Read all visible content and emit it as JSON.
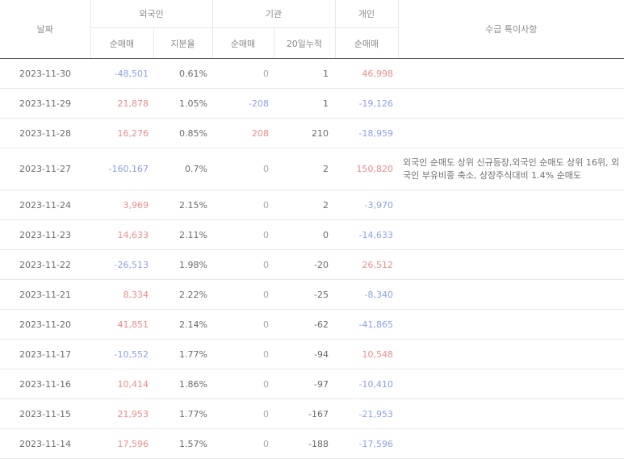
{
  "header": {
    "date": "날짜",
    "foreign": "외국인",
    "institution": "기관",
    "individual": "개인",
    "note": "수급 특이사항",
    "foreign_net": "순매매",
    "foreign_ratio": "지분율",
    "institution_net": "순매매",
    "institution_cum": "20일누적",
    "individual_net": "순매매"
  },
  "rows": [
    {
      "date": "2023-11-30",
      "foreign_net": "-48,501",
      "foreign_ratio": "0.61%",
      "institution_net": "0",
      "institution_cum": "1",
      "individual_net": "46,998",
      "note": ""
    },
    {
      "date": "2023-11-29",
      "foreign_net": "21,878",
      "foreign_ratio": "1.05%",
      "institution_net": "-208",
      "institution_cum": "1",
      "individual_net": "-19,126",
      "note": ""
    },
    {
      "date": "2023-11-28",
      "foreign_net": "16,276",
      "foreign_ratio": "0.85%",
      "institution_net": "208",
      "institution_cum": "210",
      "individual_net": "-18,959",
      "note": ""
    },
    {
      "date": "2023-11-27",
      "foreign_net": "-160,167",
      "foreign_ratio": "0.7%",
      "institution_net": "0",
      "institution_cum": "2",
      "individual_net": "150,820",
      "note": "외국인 순매도 상위 신규등장,외국인 순매도 상위 16위, 외국인 부유비중 축소, 상장주식대비 1.4% 순매도"
    },
    {
      "date": "2023-11-24",
      "foreign_net": "3,969",
      "foreign_ratio": "2.15%",
      "institution_net": "0",
      "institution_cum": "2",
      "individual_net": "-3,970",
      "note": ""
    },
    {
      "date": "2023-11-23",
      "foreign_net": "14,633",
      "foreign_ratio": "2.11%",
      "institution_net": "0",
      "institution_cum": "0",
      "individual_net": "-14,633",
      "note": ""
    },
    {
      "date": "2023-11-22",
      "foreign_net": "-26,513",
      "foreign_ratio": "1.98%",
      "institution_net": "0",
      "institution_cum": "-20",
      "individual_net": "26,512",
      "note": ""
    },
    {
      "date": "2023-11-21",
      "foreign_net": "8,334",
      "foreign_ratio": "2.22%",
      "institution_net": "0",
      "institution_cum": "-25",
      "individual_net": "-8,340",
      "note": ""
    },
    {
      "date": "2023-11-20",
      "foreign_net": "41,851",
      "foreign_ratio": "2.14%",
      "institution_net": "0",
      "institution_cum": "-62",
      "individual_net": "-41,865",
      "note": ""
    },
    {
      "date": "2023-11-17",
      "foreign_net": "-10,552",
      "foreign_ratio": "1.77%",
      "institution_net": "0",
      "institution_cum": "-94",
      "individual_net": "10,548",
      "note": ""
    },
    {
      "date": "2023-11-16",
      "foreign_net": "10,414",
      "foreign_ratio": "1.86%",
      "institution_net": "0",
      "institution_cum": "-97",
      "individual_net": "-10,410",
      "note": ""
    },
    {
      "date": "2023-11-15",
      "foreign_net": "21,953",
      "foreign_ratio": "1.77%",
      "institution_net": "0",
      "institution_cum": "-167",
      "individual_net": "-21,953",
      "note": ""
    },
    {
      "date": "2023-11-14",
      "foreign_net": "17,596",
      "foreign_ratio": "1.57%",
      "institution_net": "0",
      "institution_cum": "-188",
      "individual_net": "-17,596",
      "note": ""
    }
  ],
  "colors": {
    "positive": "#f28a8a",
    "negative": "#8aa2e8",
    "zero": "#a6a6a6",
    "text": "#6b6b6b"
  }
}
